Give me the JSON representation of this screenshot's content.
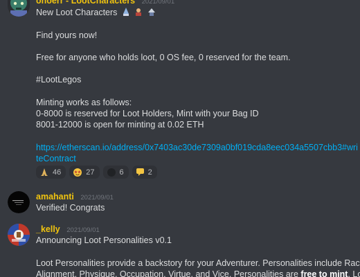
{
  "colors": {
    "background": "#36393f",
    "text": "#dcddde",
    "link": "#00aff4",
    "timestamp": "#72767d",
    "author_gold": "#f1c40f",
    "reaction_bg": "#2f3136"
  },
  "messages": [
    {
      "author": "ohoerr - LootCharacters",
      "timestamp": "2021/09/01",
      "lines": {
        "title": "New Loot Characters",
        "find": "Find yours now!",
        "free": "Free for anyone who holds loot, 0 OS fee, 0 reserved for the team.",
        "hashtag": "#LootLegos",
        "minting_header": "Minting works as follows:",
        "range1": "0-8000 is reserved for Loot Holders, Mint with your Bag ID",
        "range2": "8001-12000 is open for minting at 0.02 ETH",
        "url_part1": "https://etherscan.io/address/0x7403ac30de7309a0bf019cda8eec034a5507cbb3#wri",
        "url_part2": "teContract"
      },
      "reactions": [
        {
          "icon": "praying-hands-icon",
          "count": "46"
        },
        {
          "icon": "star-struck-icon",
          "count": "27"
        },
        {
          "icon": "dark-emoji-icon",
          "count": "6"
        },
        {
          "icon": "speech-bubble-icon",
          "count": "2"
        }
      ]
    },
    {
      "author": "amahanti",
      "timestamp": "2021/09/01",
      "text": "Verified! Congrats"
    },
    {
      "author": "_kelly",
      "timestamp": "2021/09/01",
      "lines": {
        "title": "Announcing Loot Personalities v0.1",
        "body1": "Loot Personalities provide a backstory for your Adventurer. Personalities include Race,",
        "body2_prefix": "Alignment, Physique, Occupation, Virtue, and Vice. Personalities are ",
        "body2_bold": "free to mint",
        "body2_suffix": ". Loot"
      }
    }
  ]
}
